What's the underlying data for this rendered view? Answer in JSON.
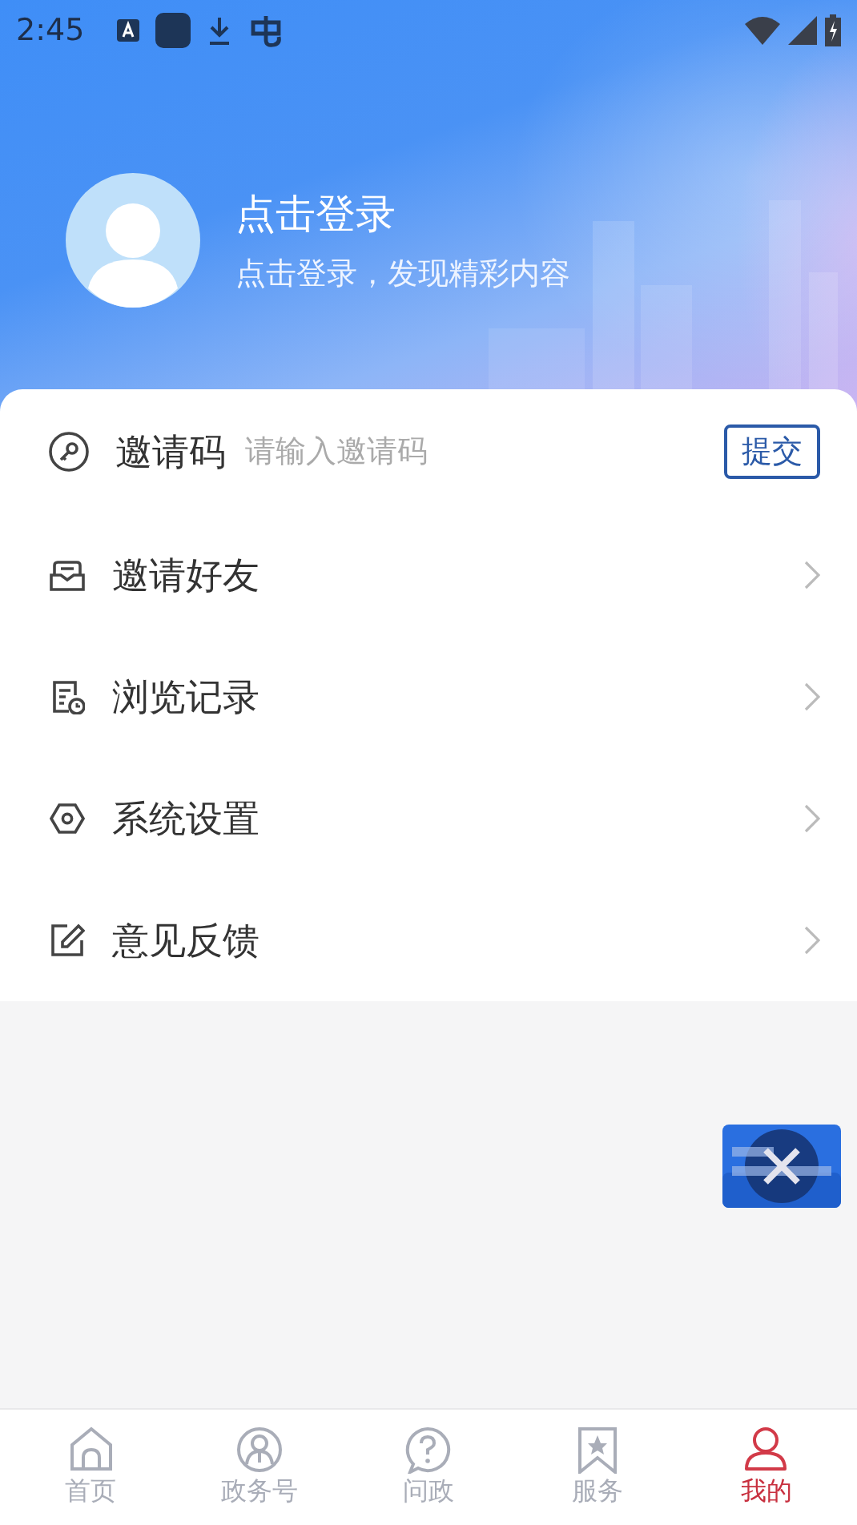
{
  "status_bar": {
    "time": "2:45"
  },
  "profile": {
    "title": "点击登录",
    "subtitle": "点击登录，发现精彩内容"
  },
  "invite": {
    "label": "邀请码",
    "placeholder": "请输入邀请码",
    "button": "提交"
  },
  "menu": [
    {
      "label": "邀请好友",
      "kind": "inbox"
    },
    {
      "label": "浏览记录",
      "kind": "history"
    },
    {
      "label": "系统设置",
      "kind": "settings"
    },
    {
      "label": "意见反馈",
      "kind": "edit"
    }
  ],
  "tab_bar": [
    {
      "label": "首页",
      "kind": "home",
      "selected": false
    },
    {
      "label": "政务号",
      "kind": "official",
      "selected": false
    },
    {
      "label": "问政",
      "kind": "question",
      "selected": false
    },
    {
      "label": "服务",
      "kind": "bookmark",
      "selected": false
    },
    {
      "label": "我的",
      "kind": "person",
      "selected": true
    }
  ]
}
